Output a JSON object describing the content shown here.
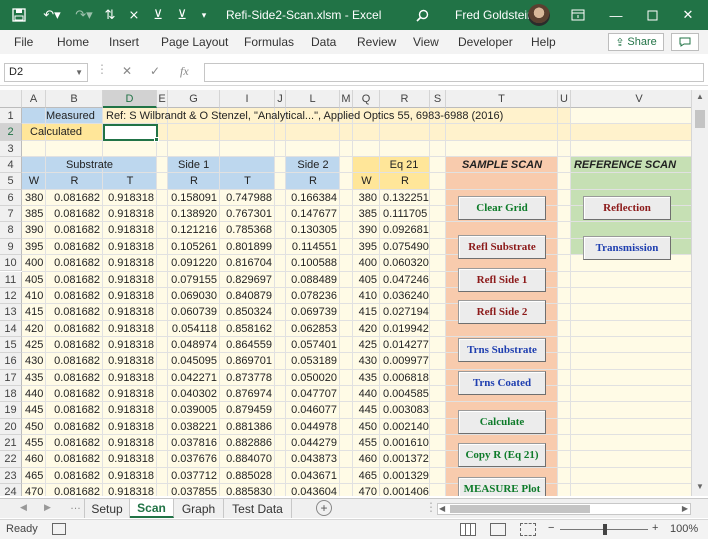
{
  "window": {
    "file_title": "Refi-Side2-Scan.xlsm  -  Excel",
    "user_name": "Fred Goldstein"
  },
  "ribbon": {
    "tabs": [
      "File",
      "Home",
      "Insert",
      "Page Layout",
      "Formulas",
      "Data",
      "Review",
      "View",
      "Developer",
      "Help"
    ],
    "share_label": "Share"
  },
  "formula_bar": {
    "name_box": "D2",
    "fx_label": "fx",
    "content": ""
  },
  "columns": [
    "A",
    "B",
    "D",
    "E",
    "G",
    "I",
    "J",
    "L",
    "M",
    "Q",
    "R",
    "S",
    "T",
    "U",
    "V"
  ],
  "selected_column": "D",
  "rows": [
    "1",
    "2",
    "3",
    "4",
    "5",
    "6",
    "7",
    "8",
    "9",
    "10",
    "11",
    "12",
    "13",
    "14",
    "15",
    "16",
    "17",
    "18",
    "19",
    "20",
    "21",
    "22",
    "23",
    "24"
  ],
  "selected_row": "2",
  "sheet": {
    "measured_label": "Measured",
    "calculated_label": "Calculated",
    "ref_text": "Ref:  S Wilbrandt & O Stenzel, \"Analytical...\", Applied Optics 55, 6983-6988 (2016)",
    "substrate_header": "Substrate",
    "side1_header": "Side 1",
    "side2_header": "Side 2",
    "eq21_header": "Eq 21",
    "subheaders": {
      "sub_w": "W",
      "sub_r": "R",
      "sub_t": "T",
      "s1_r": "R",
      "s1_t": "T",
      "s2_r": "R",
      "eq_w": "W",
      "eq_r": "R"
    },
    "data_rows": [
      [
        "380",
        "0.081682",
        "0.918318",
        "0.158091",
        "0.747988",
        "0.166384",
        "380",
        "0.132251"
      ],
      [
        "385",
        "0.081682",
        "0.918318",
        "0.138920",
        "0.767301",
        "0.147677",
        "385",
        "0.111705"
      ],
      [
        "390",
        "0.081682",
        "0.918318",
        "0.121216",
        "0.785368",
        "0.130305",
        "390",
        "0.092681"
      ],
      [
        "395",
        "0.081682",
        "0.918318",
        "0.105261",
        "0.801899",
        "0.114551",
        "395",
        "0.075490"
      ],
      [
        "400",
        "0.081682",
        "0.918318",
        "0.091220",
        "0.816704",
        "0.100588",
        "400",
        "0.060320"
      ],
      [
        "405",
        "0.081682",
        "0.918318",
        "0.079155",
        "0.829697",
        "0.088489",
        "405",
        "0.047246"
      ],
      [
        "410",
        "0.081682",
        "0.918318",
        "0.069030",
        "0.840879",
        "0.078236",
        "410",
        "0.036240"
      ],
      [
        "415",
        "0.081682",
        "0.918318",
        "0.060739",
        "0.850324",
        "0.069739",
        "415",
        "0.027194"
      ],
      [
        "420",
        "0.081682",
        "0.918318",
        "0.054118",
        "0.858162",
        "0.062853",
        "420",
        "0.019942"
      ],
      [
        "425",
        "0.081682",
        "0.918318",
        "0.048974",
        "0.864559",
        "0.057401",
        "425",
        "0.014277"
      ],
      [
        "430",
        "0.081682",
        "0.918318",
        "0.045095",
        "0.869701",
        "0.053189",
        "430",
        "0.009977"
      ],
      [
        "435",
        "0.081682",
        "0.918318",
        "0.042271",
        "0.873778",
        "0.050020",
        "435",
        "0.006818"
      ],
      [
        "440",
        "0.081682",
        "0.918318",
        "0.040302",
        "0.876974",
        "0.047707",
        "440",
        "0.004585"
      ],
      [
        "445",
        "0.081682",
        "0.918318",
        "0.039005",
        "0.879459",
        "0.046077",
        "445",
        "0.003083"
      ],
      [
        "450",
        "0.081682",
        "0.918318",
        "0.038221",
        "0.881386",
        "0.044978",
        "450",
        "0.002140"
      ],
      [
        "455",
        "0.081682",
        "0.918318",
        "0.037816",
        "0.882886",
        "0.044279",
        "455",
        "0.001610"
      ],
      [
        "460",
        "0.081682",
        "0.918318",
        "0.037676",
        "0.884070",
        "0.043873",
        "460",
        "0.001372"
      ],
      [
        "465",
        "0.081682",
        "0.918318",
        "0.037712",
        "0.885028",
        "0.043671",
        "465",
        "0.001329"
      ],
      [
        "470",
        "0.081682",
        "0.918318",
        "0.037855",
        "0.885830",
        "0.043604",
        "470",
        "0.001406"
      ]
    ]
  },
  "sample_scan": {
    "title": "SAMPLE SCAN",
    "buttons": {
      "clear_grid": "Clear Grid",
      "refl_substrate": "Refl Substrate",
      "refl_side1": "Refl Side 1",
      "refl_side2": "Refl Side 2",
      "trns_substrate": "Trns Substrate",
      "trns_coated": "Trns Coated",
      "calculate": "Calculate",
      "copy_r": "Copy R (Eq 21)",
      "measure_plot": "MEASURE Plot"
    }
  },
  "reference_scan": {
    "title": "REFERENCE SCAN",
    "buttons": {
      "reflection": "Reflection",
      "transmission": "Transmission"
    }
  },
  "sheet_tabs": [
    "Setup",
    "Scan",
    "Graph",
    "Test Data"
  ],
  "active_sheet": "Scan",
  "status": {
    "ready": "Ready",
    "zoom": "100%"
  },
  "colors": {
    "excel_green": "#217346",
    "measured_blue": "#bdd7ee",
    "calculated_yellow": "#ffe699",
    "panel_light": "#fff2cc",
    "sample_orange": "#f8cbad",
    "reference_green": "#c6e0b4",
    "grid_fill": "#fffbe6"
  }
}
